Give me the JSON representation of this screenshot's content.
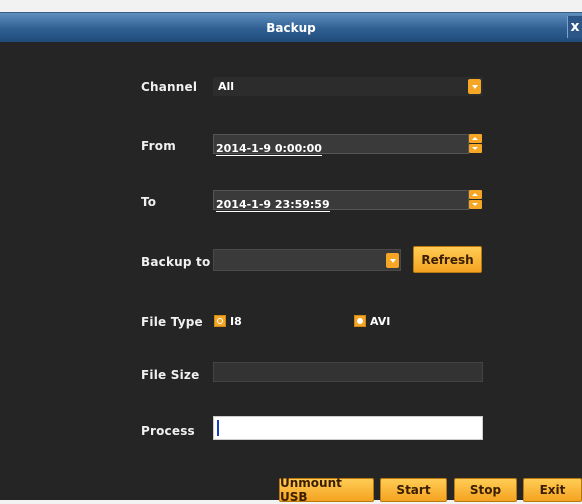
{
  "window": {
    "title": "Backup",
    "close_label": "x"
  },
  "form": {
    "channel": {
      "label": "Channel",
      "value": "All"
    },
    "from": {
      "label": "From",
      "value": "2014-1-9 0:00:00"
    },
    "to": {
      "label": "To",
      "value": "2014-1-9 23:59:59"
    },
    "backup_to": {
      "label": "Backup to",
      "value": "",
      "refresh_label": "Refresh"
    },
    "file_type": {
      "label": "File Type",
      "options": [
        "I8",
        "AVI"
      ],
      "selected": "AVI"
    },
    "file_size": {
      "label": "File Size",
      "value": ""
    },
    "process": {
      "label": "Process",
      "value": ""
    }
  },
  "actions": {
    "unmount_usb": "Unmount USB",
    "start": "Start",
    "stop": "Stop",
    "exit": "Exit"
  },
  "colors": {
    "accent": "#f5a624",
    "background": "#252525",
    "titlebar": "#2f5f92"
  }
}
